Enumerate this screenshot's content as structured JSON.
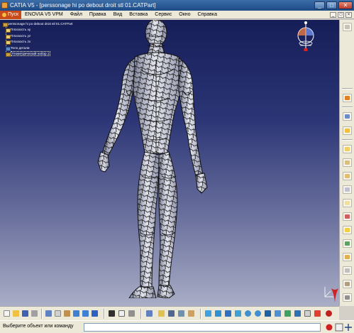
{
  "window": {
    "title": "CATIA V5 - [perssonage hi po debout droit stl 01.CATPart]",
    "buttons": {
      "minimize": "_",
      "maximize": "□",
      "close": "✕"
    }
  },
  "menu": {
    "start": "Пуск",
    "items": [
      "ENOVIA V5 VPM",
      "Файл",
      "Правка",
      "Вид",
      "Вставка",
      "Сервис",
      "Окно",
      "Справка"
    ],
    "doc_buttons": [
      "_",
      "□",
      "×"
    ]
  },
  "tree": {
    "root": "perssonage hi po debout droit stl 01.CATPart",
    "children": [
      "Плоскость xy",
      "Плоскость yz",
      "Плоскость zx",
      "Тело детали",
      "Геометрический набор.1"
    ]
  },
  "status": {
    "prompt": "Выберите объект или команду",
    "command_value": ""
  },
  "toolbars": {
    "bottom_icons": [
      "new-icon",
      "open-icon",
      "save-icon",
      "print-icon",
      "cut-icon",
      "copy-icon",
      "paste-icon",
      "undo-icon",
      "redo-icon",
      "whats-this-icon",
      "formula-icon",
      "comment-icon",
      "table-icon",
      "catalog-icon",
      "measure-icon",
      "fly-icon",
      "fit-all-icon",
      "pan-icon",
      "rotate-icon",
      "zoom-in-icon",
      "zoom-out-icon",
      "normal-view-icon",
      "iso-view-icon",
      "shading-icon",
      "hide-show-icon",
      "swap-visible-icon",
      "catia-icon"
    ],
    "right_icons": [
      "select-icon",
      "sketcher-icon",
      "sketch-icon",
      "pad-icon",
      "pocket-icon",
      "shaft-icon",
      "fillet-icon",
      "chamfer-icon",
      "draft-icon",
      "shell-icon",
      "split-icon",
      "translate-icon",
      "boolean-icon",
      "material-icon",
      "apply-material-icon",
      "analysis-icon",
      "constraint-icon",
      "render-icon",
      "reference-icon",
      "more-icon"
    ]
  },
  "colors": {
    "accent_orange": "#c84a1a",
    "viewport_top": "#161e58",
    "viewport_bottom": "#a9adc6"
  }
}
